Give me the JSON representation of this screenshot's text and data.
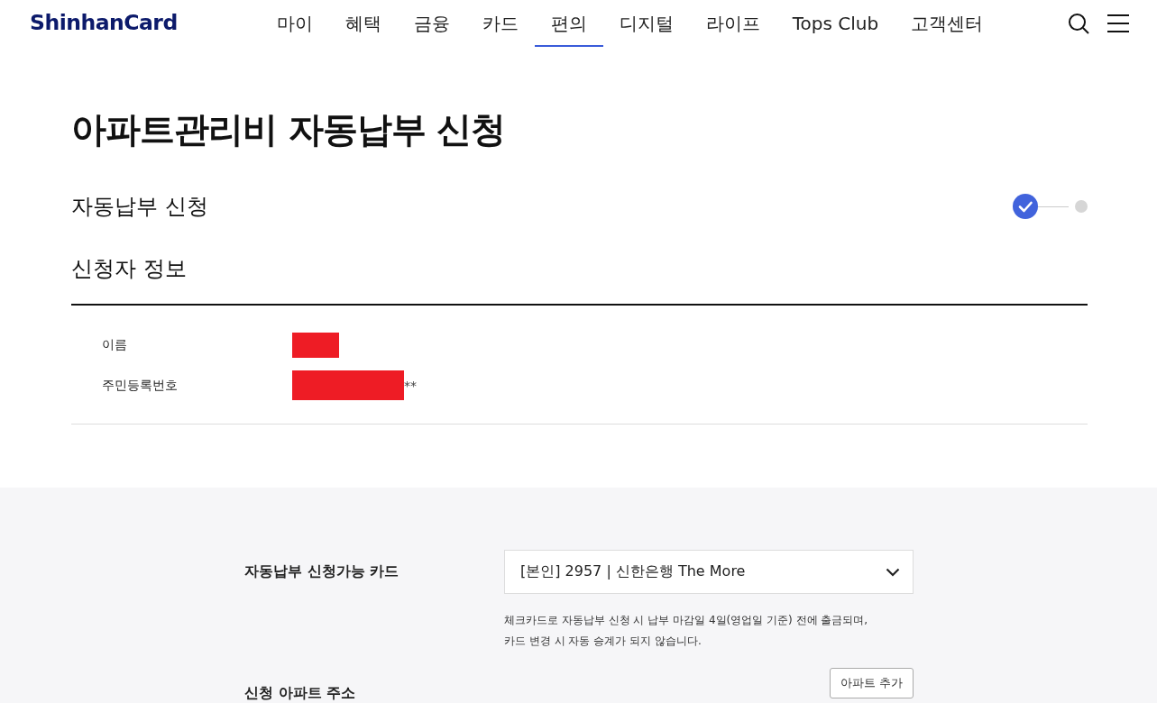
{
  "header": {
    "logo": "ShinhanCard",
    "nav": [
      {
        "label": "마이",
        "selected": false
      },
      {
        "label": "혜택",
        "selected": false
      },
      {
        "label": "금융",
        "selected": false
      },
      {
        "label": "카드",
        "selected": false
      },
      {
        "label": "편의",
        "selected": true
      },
      {
        "label": "디지털",
        "selected": false
      },
      {
        "label": "라이프",
        "selected": false
      },
      {
        "label": "Tops Club",
        "selected": false
      },
      {
        "label": "고객센터",
        "selected": false
      }
    ]
  },
  "page_title": "아파트관리비 자동납부 신청",
  "section_title": "자동납부 신청",
  "stepper": [
    {
      "completed": true
    },
    {
      "completed": false
    }
  ],
  "applicant": {
    "title": "신청자 정보",
    "fields": [
      {
        "label": "이름",
        "redacted": true
      },
      {
        "label": "주민등록번호",
        "redacted": true,
        "suffix": "**"
      }
    ]
  },
  "form": {
    "card_label": "자동납부 신청가능 카드",
    "card_select": {
      "value": "[본인] 2957 | 신한은행 The More"
    },
    "notes": [
      "체크카드로 자동납부 신청 시 납부 마감일 4일(영업일 기준) 전에 출금되며,",
      "카드 변경 시 자동 승계가 되지 않습니다."
    ],
    "address_label": "신청 아파트 주소",
    "add_button": "아파트 추가"
  }
}
